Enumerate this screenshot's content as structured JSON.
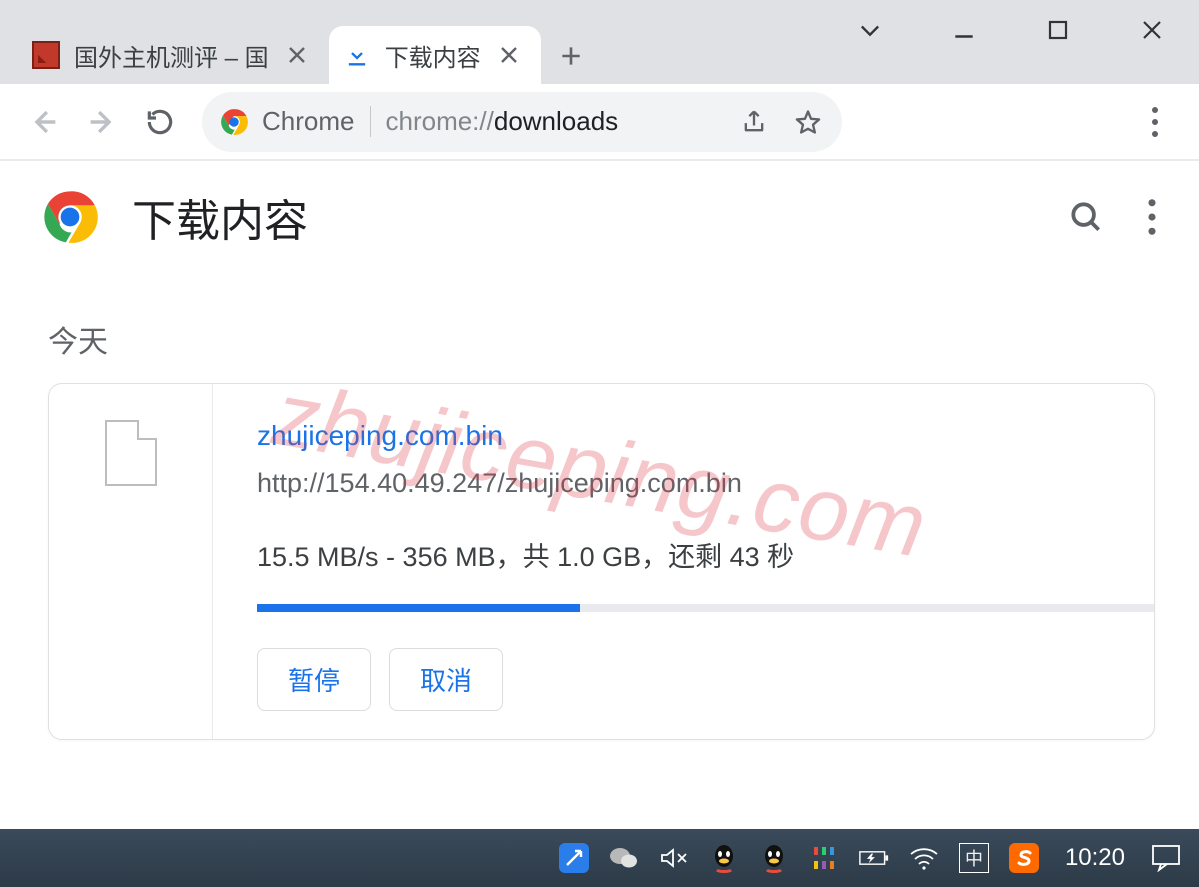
{
  "window": {
    "tabs": [
      {
        "label": "国外主机测评 – 国",
        "active": false
      },
      {
        "label": "下载内容",
        "active": true
      }
    ]
  },
  "address_bar": {
    "chip": "Chrome",
    "url_prefix": "chrome://",
    "url_bold": "downloads",
    "url_suffix": ""
  },
  "page": {
    "title": "下载内容",
    "section": "今天",
    "watermark": "zhujiceping.com"
  },
  "download": {
    "filename": "zhujiceping.com.bin",
    "url": "http://154.40.49.247/zhujiceping.com.bin",
    "speed": "15.5 MB/s",
    "downloaded": "356 MB",
    "total": "1.0 GB",
    "remaining": "43 秒",
    "progress_percent": 36,
    "status_line": "15.5 MB/s - 356 MB，共 1.0 GB，还剩 43 秒",
    "pause_label": "暂停",
    "cancel_label": "取消"
  },
  "taskbar": {
    "ime": "中",
    "clock": "10:20"
  }
}
